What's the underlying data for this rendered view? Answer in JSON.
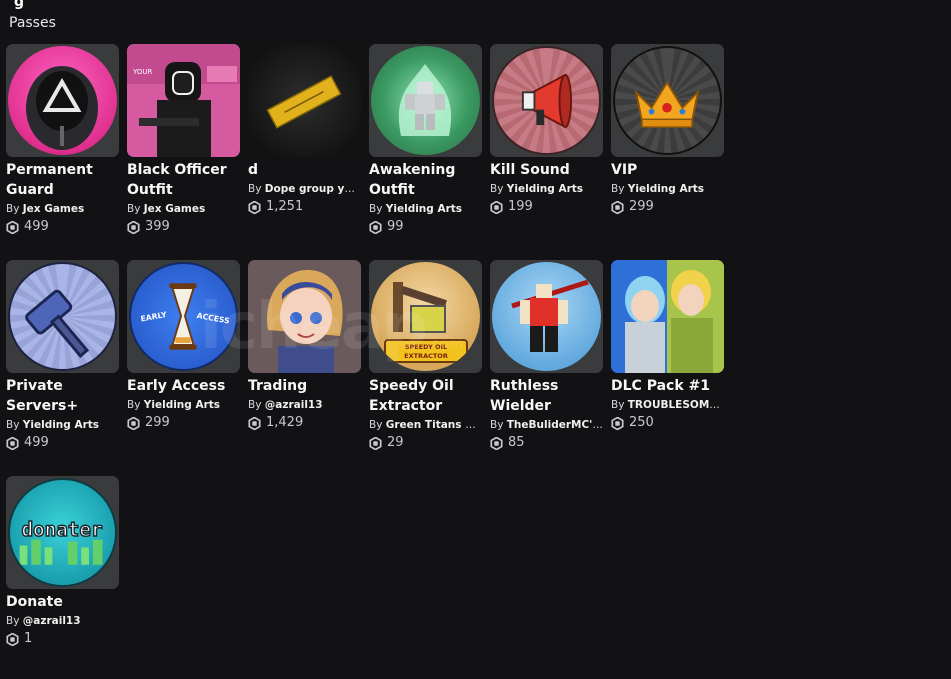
{
  "header": {
    "partial_title": "g",
    "section_title": "Passes"
  },
  "passes": [
    {
      "name": "Permanent Guard",
      "by": "By",
      "creator": "Jex Games",
      "price": "499",
      "icon": "squid-guard-triangle-icon"
    },
    {
      "name": "Black Officer Outfit",
      "by": "By",
      "creator": "Jex Games",
      "price": "399",
      "icon": "black-officer-icon"
    },
    {
      "name": "d",
      "by": "By",
      "creator": "Dope group yes y...",
      "price": "1,251",
      "icon": "gold-bar-icon"
    },
    {
      "name": "Awakening Outfit",
      "by": "By",
      "creator": "Yielding Arts",
      "price": "99",
      "icon": "awakening-aura-icon"
    },
    {
      "name": "Kill Sound",
      "by": "By",
      "creator": "Yielding Arts",
      "price": "199",
      "icon": "megaphone-icon"
    },
    {
      "name": "VIP",
      "by": "By",
      "creator": "Yielding Arts",
      "price": "299",
      "icon": "crown-icon"
    },
    {
      "name": "Private Servers+",
      "by": "By",
      "creator": "Yielding Arts",
      "price": "499",
      "icon": "hammer-icon"
    },
    {
      "name": "Early Access",
      "by": "By",
      "creator": "Yielding Arts",
      "price": "299",
      "icon": "hourglass-icon",
      "badge_left": "EARLY",
      "badge_right": "ACCESS"
    },
    {
      "name": "Trading",
      "by": "By",
      "creator": "@azrail13",
      "price": "1,429",
      "icon": "anime-girl-icon"
    },
    {
      "name": "Speedy Oil Extractor",
      "by": "By",
      "creator": "Green Titans Ent...",
      "price": "29",
      "icon": "oil-extractor-icon",
      "badge": "SPEEDY OIL EXTRACTOR"
    },
    {
      "name": "Ruthless Wielder",
      "by": "By",
      "creator": "TheBuliderMC's G...",
      "price": "85",
      "icon": "roblox-avatar-icon"
    },
    {
      "name": "DLC Pack #1",
      "by": "By",
      "creator": "TROUBLESOME B...",
      "price": "250",
      "icon": "anime-duo-icon"
    },
    {
      "name": "Donate",
      "by": "By",
      "creator": "@azrail13",
      "price": "1",
      "icon": "donater-icon",
      "badge": "donater"
    }
  ],
  "watermark": {
    "text": "icheap",
    "sub": ".com"
  },
  "colors": {
    "background": "#121215",
    "thumb_bg": "#393b3d",
    "text": "#f7f7f8"
  }
}
